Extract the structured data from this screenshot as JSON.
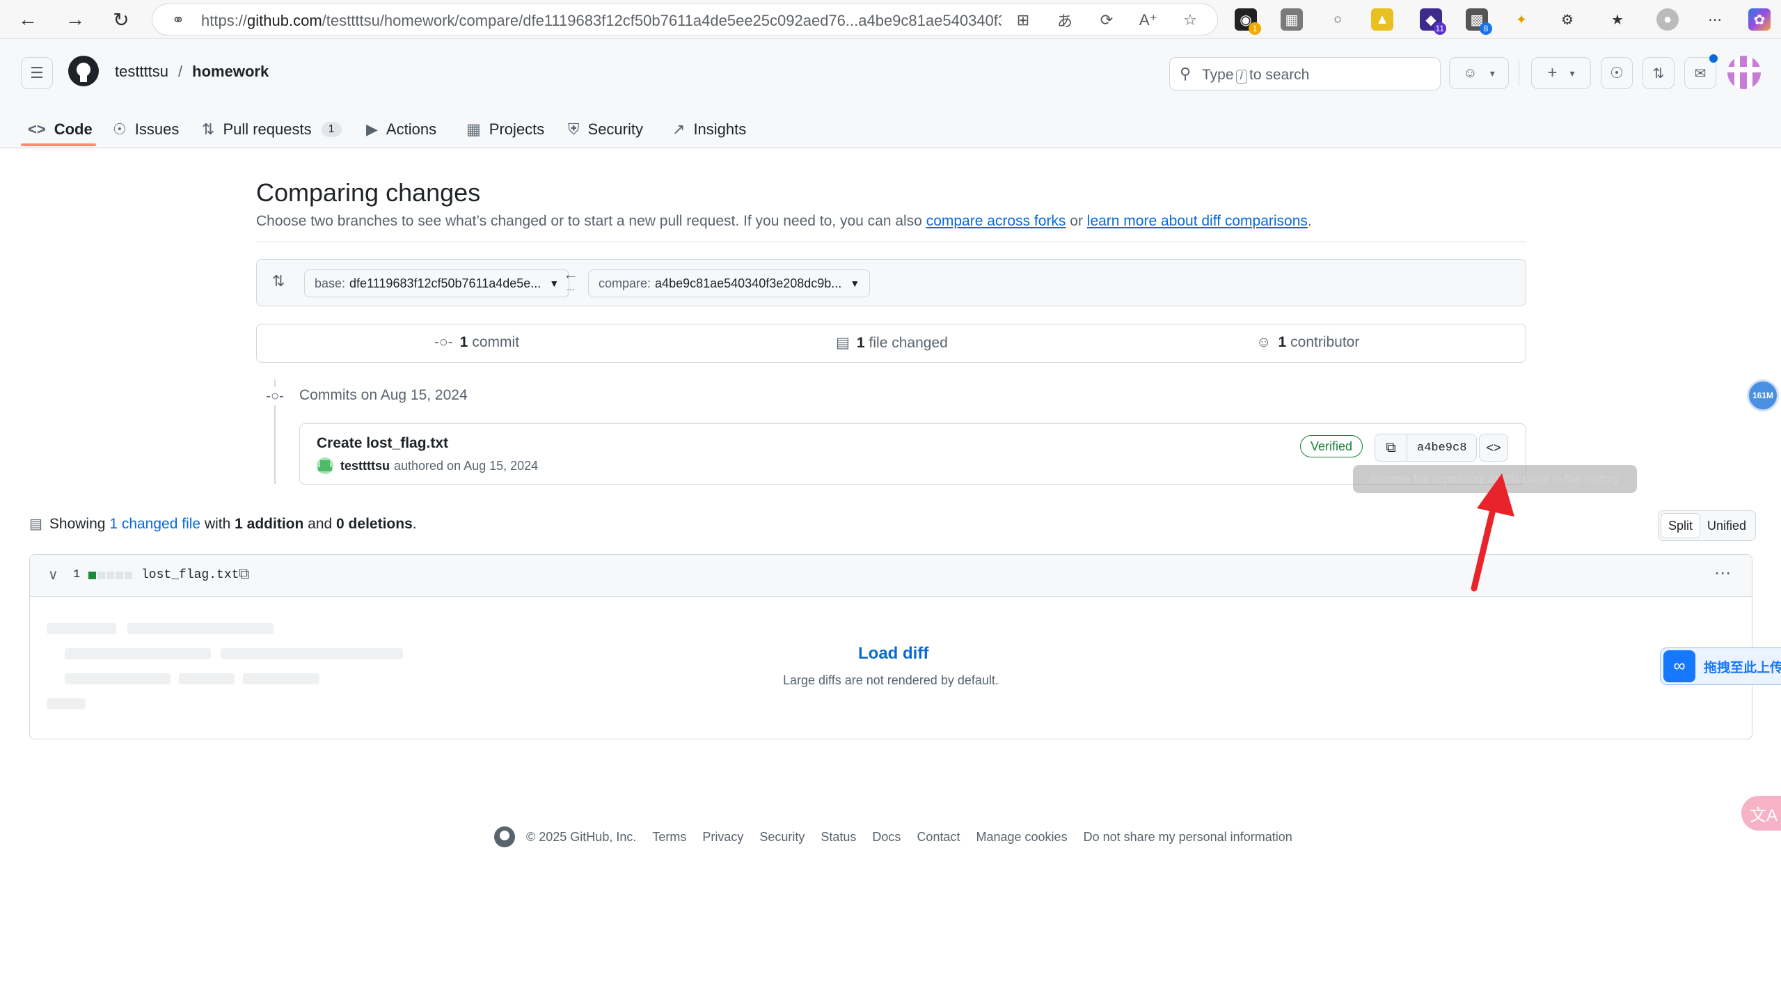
{
  "browser": {
    "url_prefix": "https://",
    "url_host": "github.com",
    "url_path": "/testtttsu/homework/compare/dfe1119683f12cf50b7611a4de5ee25c092aed76...a4be9c81ae540340f3e...",
    "extension_badges": [
      "1",
      "11",
      "8"
    ]
  },
  "repo": {
    "owner": "testtttsu",
    "separator": "/",
    "name": "homework"
  },
  "search": {
    "prefix": "Type",
    "key": "/",
    "suffix": "to search"
  },
  "tabs": [
    {
      "label": "Code",
      "icon": "code-icon"
    },
    {
      "label": "Issues",
      "icon": "issue-icon"
    },
    {
      "label": "Pull requests",
      "icon": "pull-request-icon",
      "count": "1"
    },
    {
      "label": "Actions",
      "icon": "play-icon"
    },
    {
      "label": "Projects",
      "icon": "table-icon"
    },
    {
      "label": "Security",
      "icon": "shield-icon"
    },
    {
      "label": "Insights",
      "icon": "graph-icon"
    }
  ],
  "compare": {
    "title": "Comparing changes",
    "description_start": "Choose two branches to see what’s changed or to start a new pull request. If you need to, you can also ",
    "link_forks": "compare across forks",
    "description_or": " or ",
    "link_learn": "learn more about diff comparisons",
    "description_end": ".",
    "base_label": "base:",
    "base_value": "dfe1119683f12cf50b7611a4de5e...",
    "compare_label": "compare:",
    "compare_value": "a4be9c81ae540340f3e208dc9b...",
    "arrow": "←",
    "dots": "..."
  },
  "summary": {
    "commits_count": "1",
    "commits_label": "commit",
    "files_count": "1",
    "files_label": "file changed",
    "contributors_count": "1",
    "contributors_label": "contributor"
  },
  "commits": {
    "date_heading": "Commits on Aug 15, 2024",
    "items": [
      {
        "title": "Create lost_flag.txt",
        "author": "testtttsu",
        "authored_text": "authored on Aug 15, 2024",
        "verified": "Verified",
        "sha": "a4be9c8"
      }
    ],
    "tooltip": "Browse the repository at this point in the history"
  },
  "files": {
    "showing": "Showing",
    "changed_link": "1 changed file",
    "with": "with",
    "additions": "1 addition",
    "and": "and",
    "deletions": "0 deletions",
    "end": ".",
    "view_split": "Split",
    "view_unified": "Unified",
    "file": {
      "change_count": "1",
      "name": "lost_flag.txt",
      "load_diff": "Load diff",
      "note": "Large diffs are not rendered by default."
    }
  },
  "footer": {
    "copyright": "© 2025 GitHub, Inc.",
    "links": [
      "Terms",
      "Privacy",
      "Security",
      "Status",
      "Docs",
      "Contact",
      "Manage cookies",
      "Do not share my personal information"
    ]
  },
  "overlays": {
    "floating_badge": "161M",
    "upload_text": "拖拽至此上传",
    "translate_glyph": "文A"
  },
  "colors": {
    "accent_link": "#0969da",
    "tab_underline": "#fd8c73",
    "verified": "#1a7f37",
    "annotation_arrow": "#e8242a"
  }
}
